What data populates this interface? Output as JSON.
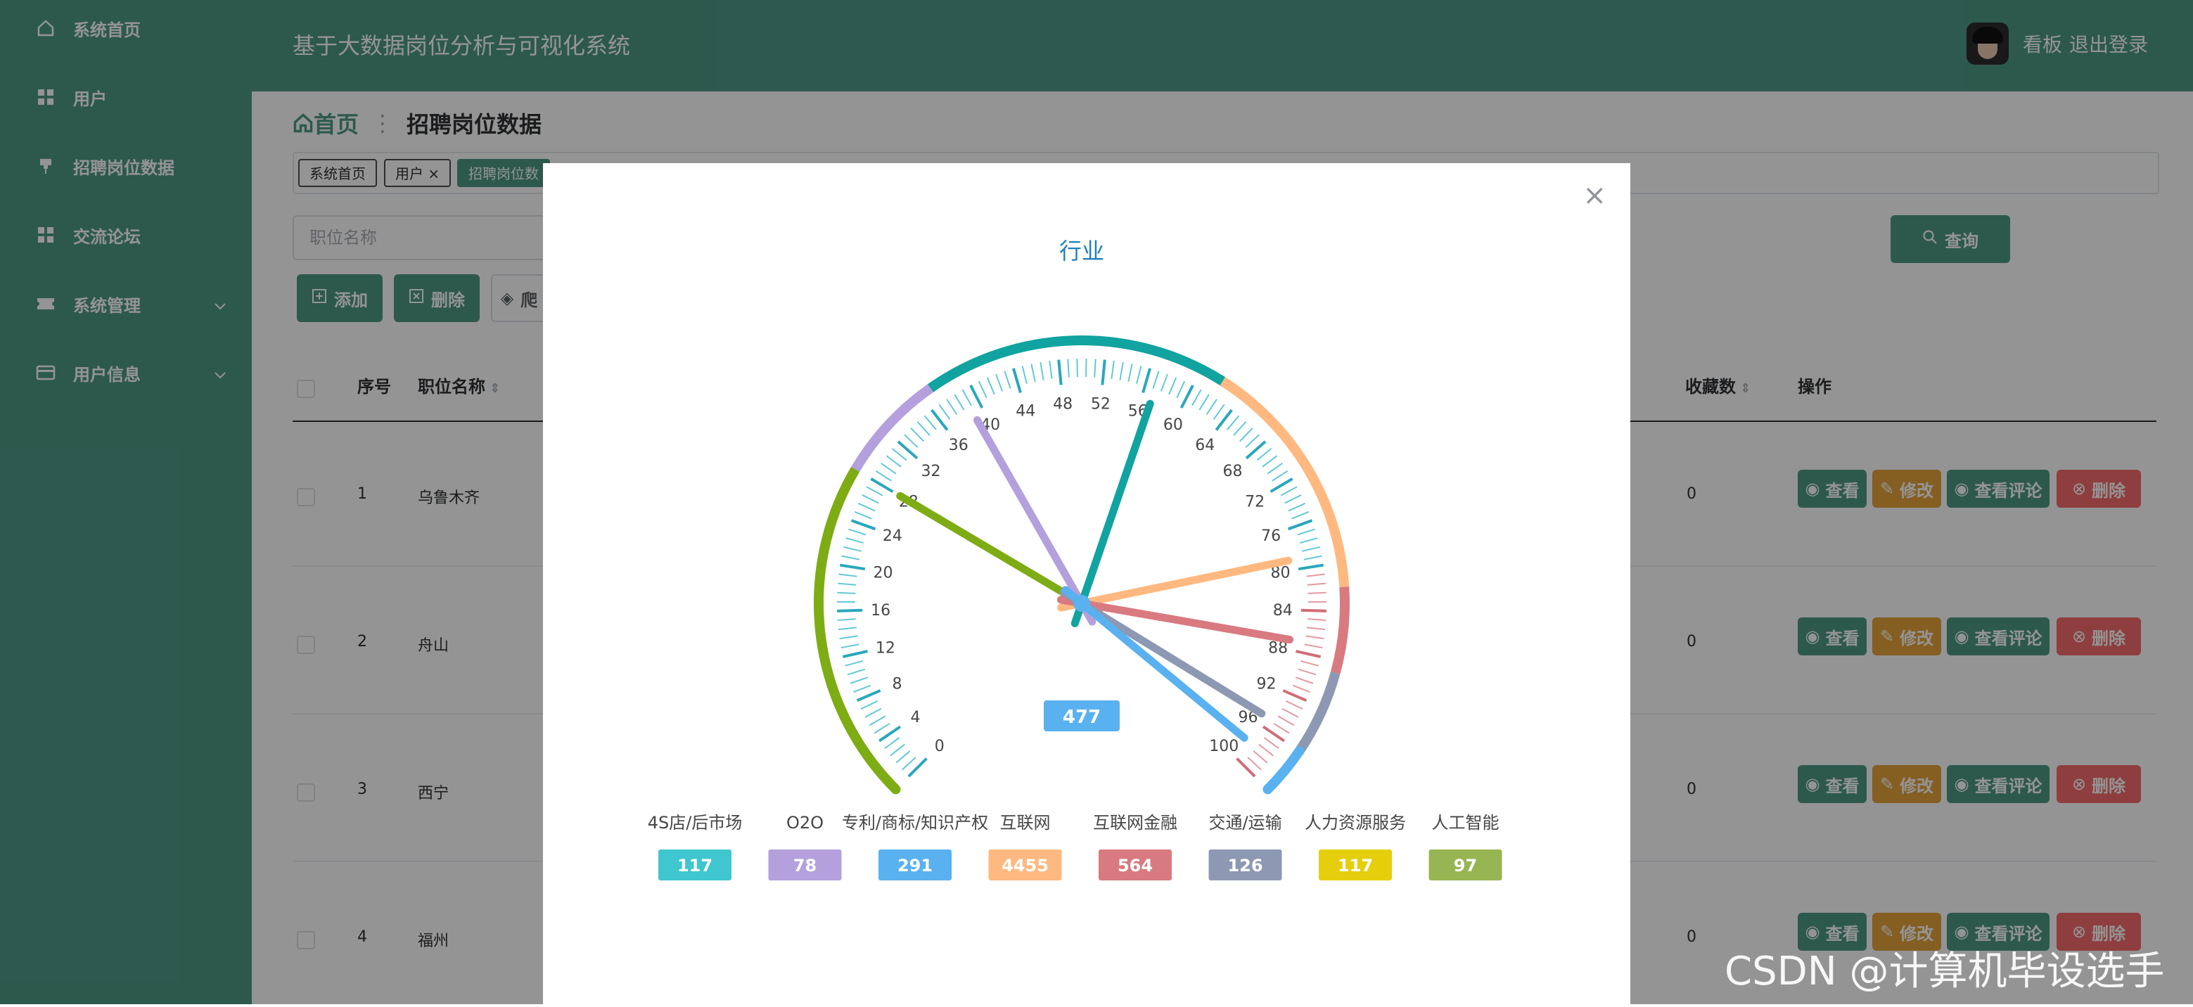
{
  "sidebar": {
    "items": [
      {
        "label": "系统首页",
        "icon": "home-icon"
      },
      {
        "label": "用户",
        "icon": "grid-icon"
      },
      {
        "label": "招聘岗位数据",
        "icon": "pin-icon"
      },
      {
        "label": "交流论坛",
        "icon": "grid-icon"
      },
      {
        "label": "系统管理",
        "icon": "ticket-icon",
        "has_children": true
      },
      {
        "label": "用户信息",
        "icon": "card-icon",
        "has_children": true
      }
    ]
  },
  "header": {
    "title": "基于大数据岗位分析与可视化系统",
    "board": "看板",
    "logout": "退出登录"
  },
  "breadcrumb": {
    "home": "首页",
    "current": "招聘岗位数据"
  },
  "tabs": [
    {
      "label": "系统首页",
      "active": false
    },
    {
      "label": "用户",
      "active": false,
      "closable": true
    },
    {
      "label": "招聘岗位数",
      "active": true
    }
  ],
  "search": {
    "placeholder": "职位名称",
    "query_label": "查询"
  },
  "toolbar": {
    "add_label": "添加",
    "delete_label": "删除",
    "crawl_label": "爬"
  },
  "table": {
    "columns": {
      "index": "序号",
      "name": "职位名称",
      "favorites": "收藏数",
      "actions": "操作"
    },
    "rows": [
      {
        "index": "1",
        "name": "乌鲁木齐",
        "favorites": "0"
      },
      {
        "index": "2",
        "name": "舟山",
        "favorites": "0"
      },
      {
        "index": "3",
        "name": "西宁",
        "favorites": "0"
      },
      {
        "index": "4",
        "name": "福州",
        "favorites": "0"
      }
    ],
    "actions": {
      "view": "查看",
      "edit": "修改",
      "comments": "查看评论",
      "delete": "删除"
    }
  },
  "colors": {
    "primary": "#4e9a86",
    "warning": "#e6a23c",
    "danger": "#f56c6c"
  },
  "dialog": {
    "close": "×"
  },
  "chart_data": {
    "type": "gauge",
    "title": "行业",
    "min": 0,
    "max": 100,
    "tick_labels": [
      "0",
      "4",
      "8",
      "12",
      "16",
      "20",
      "24",
      "28",
      "32",
      "36",
      "40",
      "44",
      "48",
      "52",
      "56",
      "60",
      "64",
      "68",
      "72",
      "76",
      "80",
      "84",
      "88",
      "92",
      "96",
      "100"
    ],
    "center_value": "477",
    "series": [
      {
        "name": "4S店/后市场",
        "value": 117,
        "color": "#3fc6cf"
      },
      {
        "name": "O2O",
        "value": 78,
        "color": "#b4a0dc"
      },
      {
        "name": "专利/商标/知识产权",
        "value": 291,
        "color": "#5ab1ef"
      },
      {
        "name": "互联网",
        "value": 4455,
        "color": "#ffb980"
      },
      {
        "name": "互联网金融",
        "value": 564,
        "color": "#d87a80"
      },
      {
        "name": "交通/运输",
        "value": 126,
        "color": "#8d98b3"
      },
      {
        "name": "人力资源服务",
        "value": 117,
        "color": "#e5cf0d"
      },
      {
        "name": "人工智能",
        "value": 97,
        "color": "#97b552"
      }
    ],
    "pointers": [
      {
        "value": 28,
        "color": "#7eac14"
      },
      {
        "value": 39,
        "color": "#b4a0dc"
      },
      {
        "value": 57,
        "color": "#11a3a0"
      },
      {
        "value": 79,
        "color": "#ffb980"
      },
      {
        "value": 87,
        "color": "#d87a80"
      },
      {
        "value": 95,
        "color": "#8d98b3"
      },
      {
        "value": 98,
        "color": "#5ab1ef"
      }
    ]
  },
  "watermark": "CSDN @计算机毕设选手"
}
